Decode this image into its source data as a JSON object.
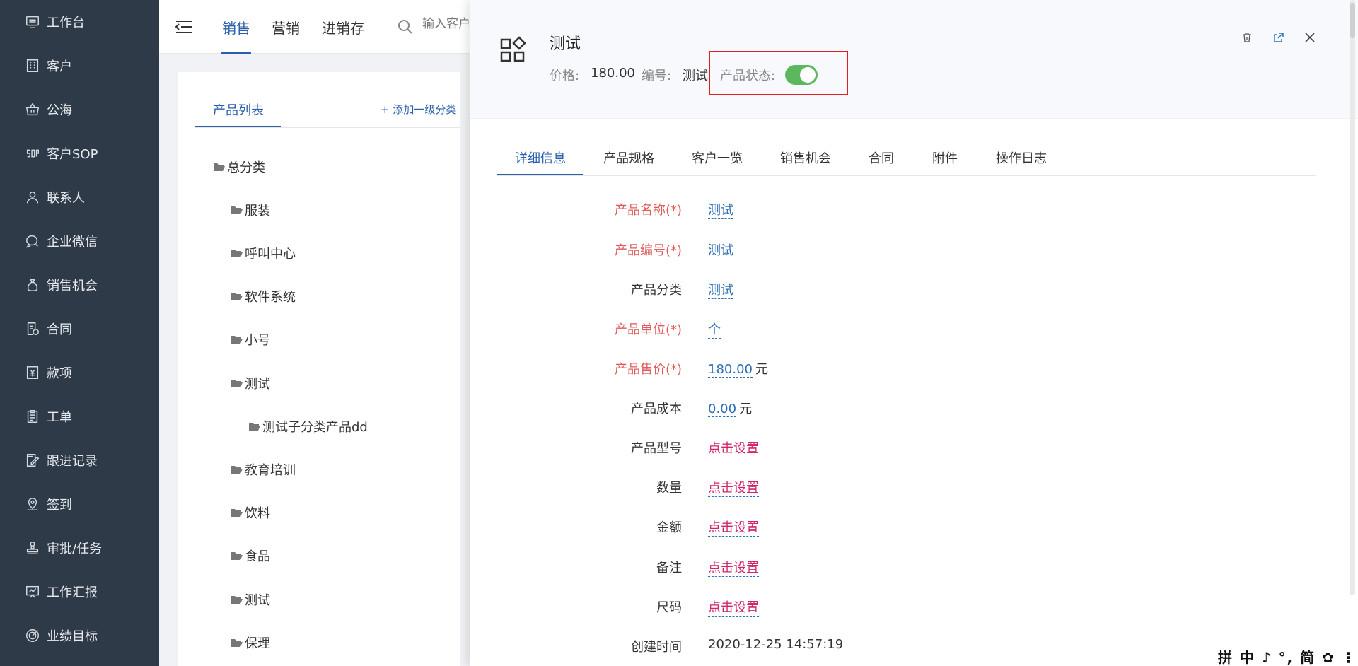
{
  "sidebar": {
    "items": [
      {
        "label": "工作台",
        "icon": "desktop-icon"
      },
      {
        "label": "客户",
        "icon": "building-icon"
      },
      {
        "label": "公海",
        "icon": "basket-icon"
      },
      {
        "label": "客户SOP",
        "icon": "sop-icon"
      },
      {
        "label": "联系人",
        "icon": "person-icon"
      },
      {
        "label": "企业微信",
        "icon": "chat-icon"
      },
      {
        "label": "销售机会",
        "icon": "money-bag-icon"
      },
      {
        "label": "合同",
        "icon": "contract-icon"
      },
      {
        "label": "款项",
        "icon": "yen-icon"
      },
      {
        "label": "工单",
        "icon": "clipboard-icon"
      },
      {
        "label": "跟进记录",
        "icon": "edit-icon"
      },
      {
        "label": "签到",
        "icon": "location-icon"
      },
      {
        "label": "审批/任务",
        "icon": "stamp-icon"
      },
      {
        "label": "工作汇报",
        "icon": "report-icon"
      },
      {
        "label": "业绩目标",
        "icon": "target-icon"
      }
    ]
  },
  "topbar": {
    "tabs": [
      "销售",
      "营销",
      "进销存"
    ],
    "search_placeholder": "输入客户"
  },
  "tree": {
    "tab": "产品列表",
    "add_label": "+ 添加一级分类",
    "nodes": [
      "总分类",
      "服装",
      "呼叫中心",
      "软件系统",
      "小号",
      "测试",
      "测试子分类产品dd",
      "教育培训",
      "饮料",
      "食品",
      "测试",
      "保理"
    ]
  },
  "drawer": {
    "title": "测试",
    "price_label": "价格:",
    "price_value": "180.00",
    "code_label": "编号:",
    "code_value": "测试",
    "status_label": "产品状态:",
    "status_on": true,
    "tabs": [
      "详细信息",
      "产品规格",
      "客户一览",
      "销售机会",
      "合同",
      "附件",
      "操作日志"
    ],
    "fields": [
      {
        "label": "产品名称(*)",
        "value": "测试",
        "required": true
      },
      {
        "label": "产品编号(*)",
        "value": "测试",
        "required": true
      },
      {
        "label": "产品分类",
        "value": "测试",
        "required": false
      },
      {
        "label": "产品单位(*)",
        "value": "个",
        "required": true
      },
      {
        "label": "产品售价(*)",
        "value": "180.00",
        "unit": "元",
        "required": true
      },
      {
        "label": "产品成本",
        "value": "0.00",
        "unit": "元",
        "required": false
      },
      {
        "label": "产品型号",
        "value": "点击设置",
        "required": false
      },
      {
        "label": "数量",
        "value": "点击设置",
        "required": false
      },
      {
        "label": "金额",
        "value": "点击设置",
        "required": false
      },
      {
        "label": "备注",
        "value": "点击设置",
        "required": false
      },
      {
        "label": "尺码",
        "value": "点击设置",
        "required": false
      },
      {
        "label": "创建时间",
        "value": "2020-12-25 14:57:19",
        "required": false
      }
    ]
  },
  "ime": "拼 中 ♪ °, 简 ✿ ⋮"
}
